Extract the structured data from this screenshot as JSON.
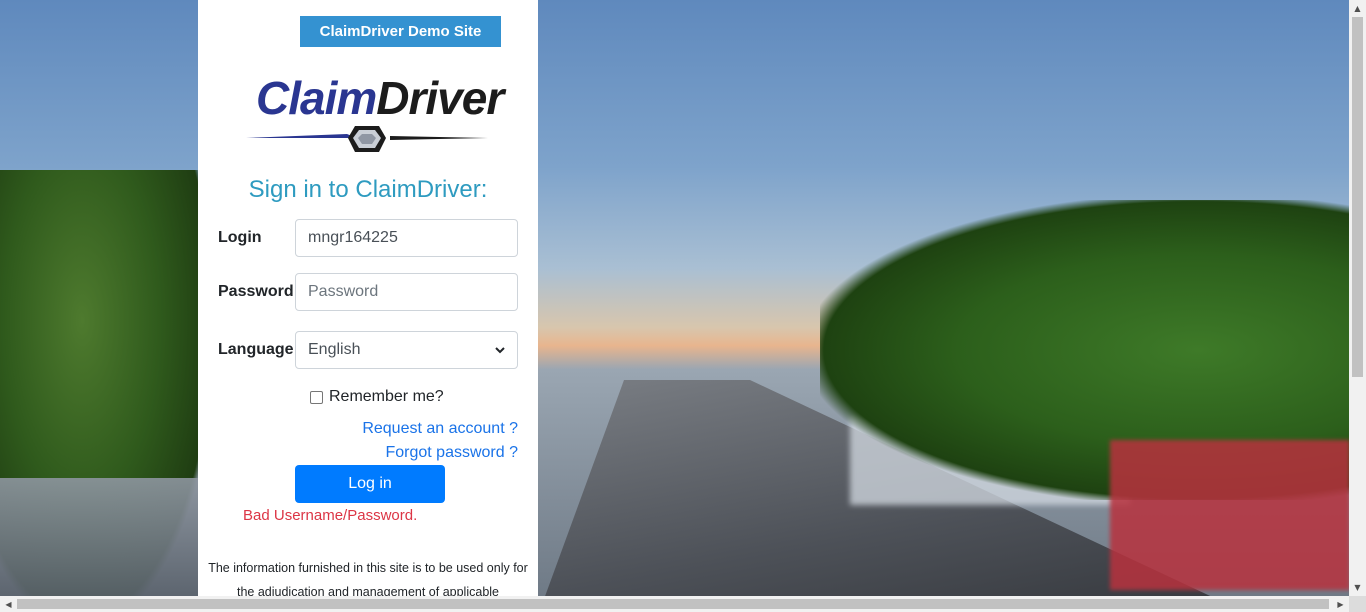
{
  "panel": {
    "badge": "ClaimDriver Demo Site",
    "logo_part1": "Claim",
    "logo_part2": "Driver",
    "title": "Sign in to ClaimDriver:",
    "login_label": "Login",
    "login_value": "mngr164225",
    "password_label": "Password",
    "password_placeholder": "Password",
    "language_label": "Language",
    "language_selected": "English",
    "remember_label": "Remember me?",
    "request_link": "Request an account ?",
    "forgot_link": "Forgot password ?",
    "login_button": "Log in",
    "error": "Bad Username/Password.",
    "disclaimer": "The information furnished in this site is to be used only for the adjudication and management of applicable"
  },
  "icons": {
    "select_arrow": "chevron-down-icon",
    "scroll_up": "arrow-up-icon",
    "scroll_down": "arrow-down-icon",
    "scroll_left": "arrow-left-icon",
    "scroll_right": "arrow-right-icon"
  },
  "colors": {
    "badge": "#3492d1",
    "title": "#2e9bc0",
    "button": "#007bff",
    "error": "#dc3545",
    "link": "#1a73e8",
    "logo_blue": "#2a3691"
  }
}
